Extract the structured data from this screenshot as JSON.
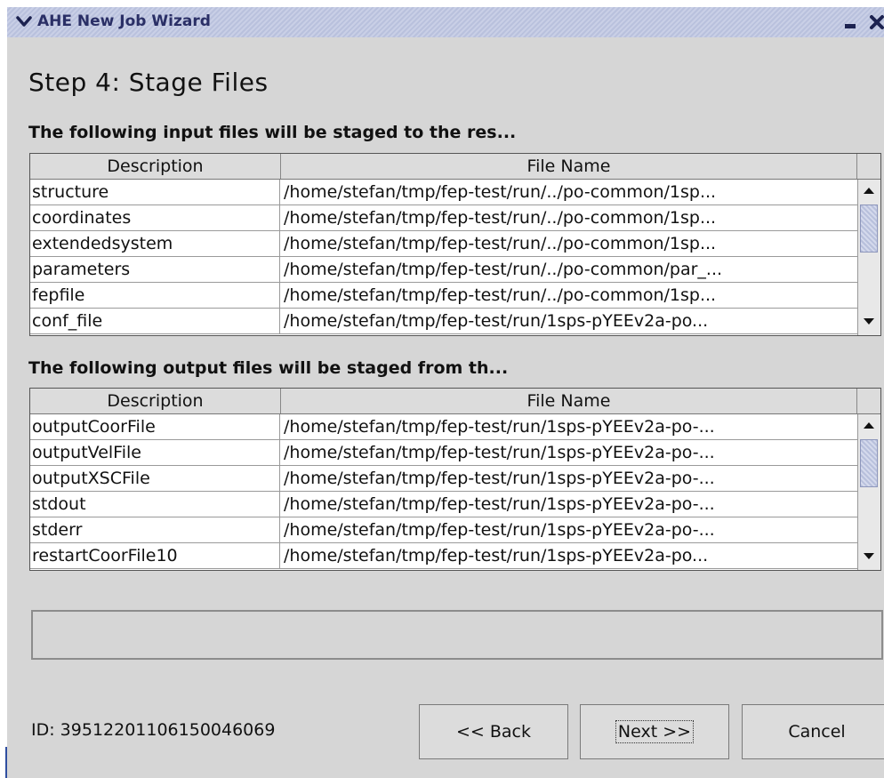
{
  "window": {
    "title": "AHE New Job Wizard",
    "icons": {
      "menu": "chevron-down-icon",
      "minimize": "minimize-icon",
      "close": "close-icon"
    }
  },
  "step": {
    "title": "Step 4: Stage Files"
  },
  "input_section": {
    "label": "The following input files will be staged to the res...",
    "columns": [
      "Description",
      "File Name"
    ],
    "rows": [
      {
        "description": "structure",
        "file": "/home/stefan/tmp/fep-test/run/../po-common/1sp..."
      },
      {
        "description": "coordinates",
        "file": "/home/stefan/tmp/fep-test/run/../po-common/1sp..."
      },
      {
        "description": "extendedsystem",
        "file": "/home/stefan/tmp/fep-test/run/../po-common/1sp..."
      },
      {
        "description": "parameters",
        "file": "/home/stefan/tmp/fep-test/run/../po-common/par_..."
      },
      {
        "description": "fepfile",
        "file": "/home/stefan/tmp/fep-test/run/../po-common/1sp..."
      },
      {
        "description": "conf_file",
        "file": "/home/stefan/tmp/fep-test/run/1sps-pYEEv2a-po..."
      }
    ]
  },
  "output_section": {
    "label": "The following output files will be staged from th...",
    "columns": [
      "Description",
      "File Name"
    ],
    "rows": [
      {
        "description": "outputCoorFile",
        "file": "/home/stefan/tmp/fep-test/run/1sps-pYEEv2a-po-..."
      },
      {
        "description": "outputVelFile",
        "file": "/home/stefan/tmp/fep-test/run/1sps-pYEEv2a-po-..."
      },
      {
        "description": "outputXSCFile",
        "file": "/home/stefan/tmp/fep-test/run/1sps-pYEEv2a-po-..."
      },
      {
        "description": "stdout",
        "file": "/home/stefan/tmp/fep-test/run/1sps-pYEEv2a-po-..."
      },
      {
        "description": "stderr",
        "file": "/home/stefan/tmp/fep-test/run/1sps-pYEEv2a-po-..."
      },
      {
        "description": "restartCoorFile10",
        "file": "/home/stefan/tmp/fep-test/run/1sps-pYEEv2a-po..."
      }
    ]
  },
  "footer": {
    "id_text": "ID: 39512201106150046069",
    "back_label": "<< Back",
    "next_label": "Next >>",
    "cancel_label": "Cancel"
  }
}
